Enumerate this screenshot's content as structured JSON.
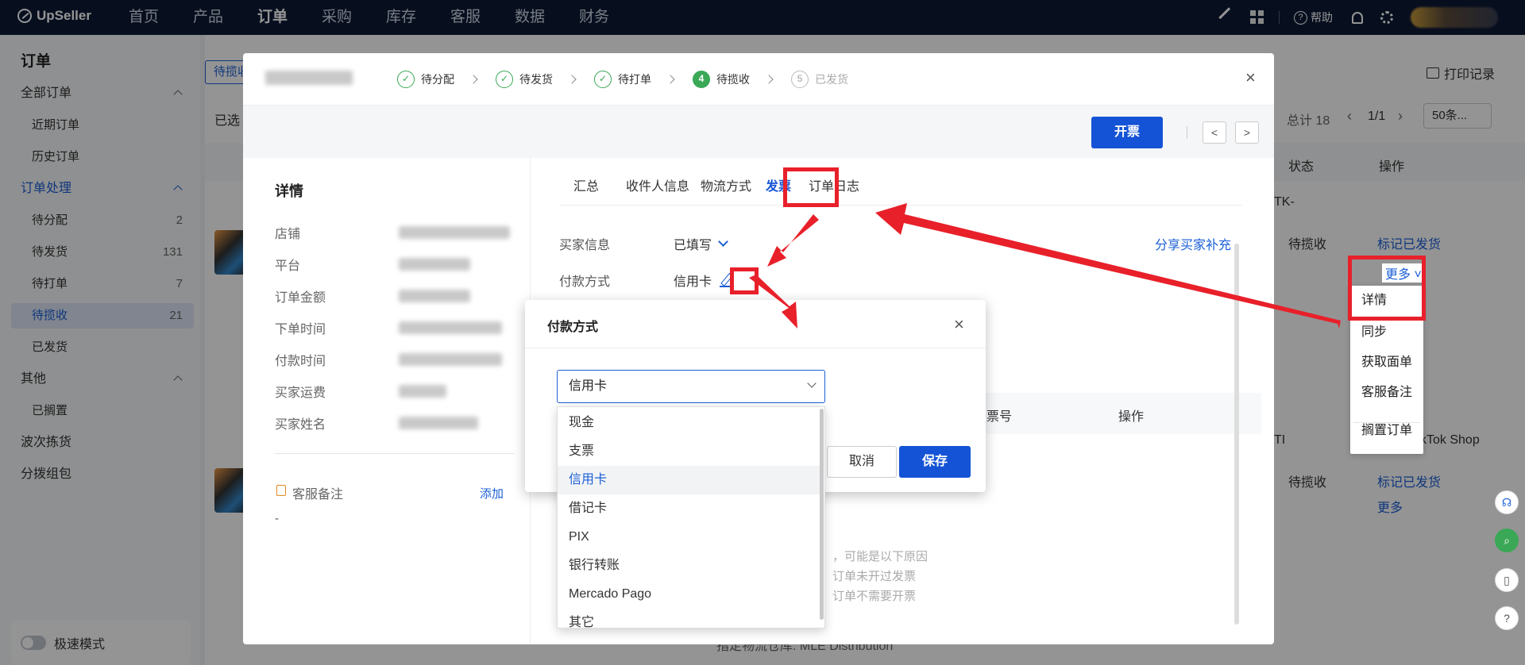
{
  "topnav": {
    "logo": "UpSeller",
    "items": [
      "首页",
      "产品",
      "订单",
      "采购",
      "库存",
      "客服",
      "数据",
      "财务"
    ],
    "active_index": 2,
    "help": "帮助"
  },
  "sidebar": {
    "title": "订单",
    "all_orders": "全部订单",
    "recent": "近期订单",
    "history": "历史订单",
    "processing": "订单处理",
    "items": [
      {
        "label": "待分配",
        "count": "2"
      },
      {
        "label": "待发货",
        "count": "131"
      },
      {
        "label": "待打单",
        "count": "7"
      },
      {
        "label": "待揽收",
        "count": "21"
      },
      {
        "label": "已发货",
        "count": ""
      }
    ],
    "other": "其他",
    "shelved": "已搁置",
    "wave": "波次拣货",
    "dispatch": "分拨组包",
    "fast_mode": "极速模式"
  },
  "background": {
    "tab": "待揽收",
    "selected": "已选",
    "print_record": "打印记录",
    "total": "总计 18",
    "page": "1/1",
    "per_page": "50条...",
    "col_status": "状态",
    "col_action": "操作",
    "row1_status": "待揽收",
    "row1_action": "标记已发货",
    "row1_more": "更多",
    "row2_status": "待揽收",
    "row2_action": "标记已发货",
    "row2_more": "更多",
    "tiktok": "kTok Shop",
    "bottom_text": "指定物流仓库: MLE Distribution",
    "tk_prefix": "TK-",
    "ti_prefix": "TI"
  },
  "more_menu": [
    "详情",
    "同步",
    "获取面单",
    "客服备注",
    "搁置订单"
  ],
  "modal": {
    "steps": [
      {
        "num": "✓",
        "label": "待分配",
        "state": "done"
      },
      {
        "num": "✓",
        "label": "待发货",
        "state": "done"
      },
      {
        "num": "✓",
        "label": "待打单",
        "state": "done"
      },
      {
        "num": "4",
        "label": "待揽收",
        "state": "current"
      },
      {
        "num": "5",
        "label": "已发货",
        "state": "todo"
      }
    ],
    "close": "×",
    "invoice_button": "开票",
    "prev": "<",
    "next": ">",
    "details_title": "详情",
    "detail_labels": [
      "店铺",
      "平台",
      "订单金额",
      "下单时间",
      "付款时间",
      "买家运费",
      "买家姓名"
    ],
    "note_label": "客服备注",
    "note_add": "添加",
    "note_value": "-",
    "tabs": [
      "汇总",
      "收件人信息",
      "物流方式",
      "发票",
      "订单日志"
    ],
    "active_tab": 3,
    "buyer_info_label": "买家信息",
    "buyer_info_value": "已填写",
    "share": "分享买家补充",
    "payment_label": "付款方式",
    "payment_value": "信用卡",
    "invoice_no": "发票号",
    "action": "操作",
    "empty_lines": [
      "，可能是以下原因",
      "订单未开过发票",
      "订单不需要开票"
    ]
  },
  "payment_dialog": {
    "title": "付款方式",
    "close": "×",
    "selected": "信用卡",
    "options": [
      "现金",
      "支票",
      "信用卡",
      "借记卡",
      "PIX",
      "银行转账",
      "Mercado Pago",
      "其它"
    ],
    "cancel": "取消",
    "save": "保存"
  },
  "colors": {
    "nav_bg": "#0d1a36",
    "primary": "#1453d6",
    "success": "#3aa856",
    "highlight": "#e8202a"
  }
}
